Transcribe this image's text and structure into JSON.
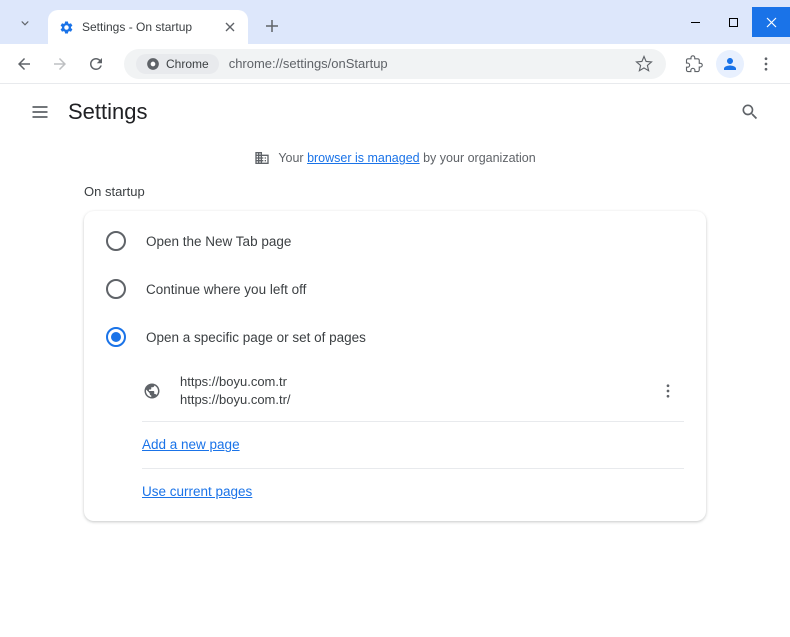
{
  "tab": {
    "title": "Settings - On startup"
  },
  "omnibox": {
    "chip_label": "Chrome",
    "url": "chrome://settings/onStartup"
  },
  "header": {
    "title": "Settings"
  },
  "managed": {
    "prefix": "Your",
    "link": "browser is managed",
    "suffix": "by your organization"
  },
  "section": {
    "label": "On startup"
  },
  "options": {
    "new_tab": "Open the New Tab page",
    "continue": "Continue where you left off",
    "specific": "Open a specific page or set of pages"
  },
  "page": {
    "title": "https://boyu.com.tr",
    "url": "https://boyu.com.tr/"
  },
  "links": {
    "add": "Add a new page",
    "current": "Use current pages"
  }
}
